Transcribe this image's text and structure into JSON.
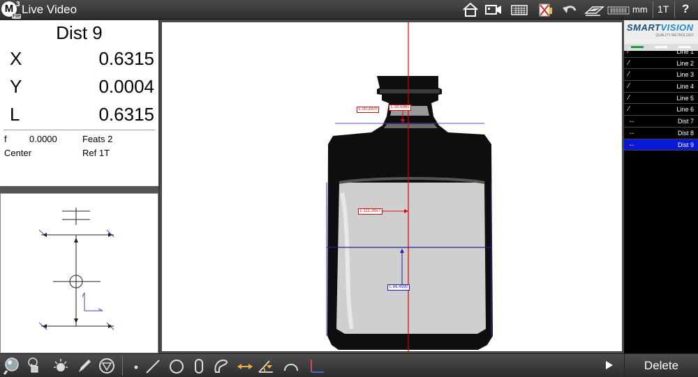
{
  "topbar": {
    "logo_letter": "M",
    "logo_superscript": "3",
    "file_label": "File",
    "title": "Live Video",
    "unit": "mm",
    "reference": "1T",
    "help": "?"
  },
  "readout": {
    "feature": "Dist 9",
    "rows": [
      {
        "axis": "X",
        "value": "0.6315"
      },
      {
        "axis": "Y",
        "value": "0.0004"
      },
      {
        "axis": "L",
        "value": "0.6315"
      }
    ],
    "f_label": "f",
    "f_value": "0.0000",
    "feats": "Feats 2",
    "center": "Center",
    "ref": "Ref 1T"
  },
  "video": {
    "labels": [
      {
        "text": "L 20.2970",
        "color": "#d01010"
      },
      {
        "text": "L 33.5961",
        "color": "#d01010"
      },
      {
        "text": "L 111.2657",
        "color": "#d01010"
      },
      {
        "text": "L 66.4930",
        "color": "#2020a0"
      }
    ]
  },
  "brand": {
    "name_a": "SMART",
    "name_b": "VISION",
    "tagline": "QUALITY METROLOGY"
  },
  "features": [
    {
      "name": "Line 1",
      "kind": "line",
      "icon": "line-icon"
    },
    {
      "name": "Line 2",
      "kind": "line",
      "icon": "line-icon"
    },
    {
      "name": "Line 3",
      "kind": "line",
      "icon": "line-icon"
    },
    {
      "name": "Line 4",
      "kind": "line",
      "icon": "line-icon"
    },
    {
      "name": "Line 5",
      "kind": "line",
      "icon": "line-icon"
    },
    {
      "name": "Line 6",
      "kind": "line",
      "icon": "line-icon"
    },
    {
      "name": "Dist 7",
      "kind": "dist",
      "icon": "distance-icon"
    },
    {
      "name": "Dist 8",
      "kind": "dist",
      "icon": "distance-icon"
    },
    {
      "name": "Dist 9",
      "kind": "dist",
      "icon": "distance-icon",
      "selected": true
    }
  ],
  "bottombar": {
    "delete_label": "Delete"
  },
  "colors": {
    "selected": "#0a18d8",
    "measure_red": "#e00000",
    "measure_blue": "#2020a0",
    "dist_icon": "#f0b040"
  }
}
